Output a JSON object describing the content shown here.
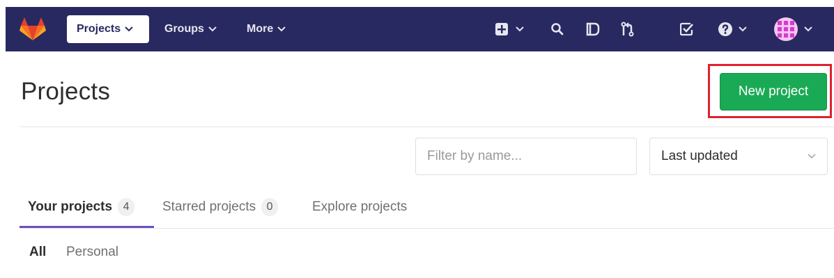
{
  "navbar": {
    "brand_color": "#292961",
    "items": [
      {
        "label": "Projects"
      },
      {
        "label": "Groups"
      },
      {
        "label": "More"
      }
    ],
    "icons": [
      "plus-square-icon",
      "search-icon",
      "issues-icon",
      "merge-request-icon",
      "todo-icon",
      "help-icon",
      "user-avatar"
    ]
  },
  "page": {
    "title": "Projects",
    "new_project_label": "New project",
    "new_project_color": "#1aaa55",
    "highlight_color": "#e0202e"
  },
  "filter": {
    "placeholder": "Filter by name...",
    "sort_selected": "Last updated"
  },
  "tabs": [
    {
      "label": "Your projects",
      "count": "4"
    },
    {
      "label": "Starred projects",
      "count": "0"
    },
    {
      "label": "Explore projects"
    }
  ],
  "subfilters": [
    {
      "label": "All"
    },
    {
      "label": "Personal"
    }
  ]
}
